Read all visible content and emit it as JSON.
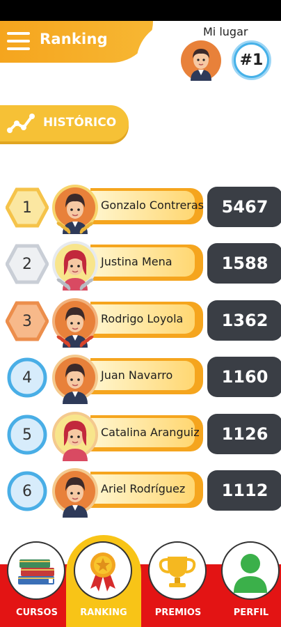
{
  "header": {
    "title": "Ranking",
    "my_place_label": "Mi lugar",
    "my_rank": "#1"
  },
  "historico": {
    "label": "HISTÓRICO"
  },
  "ranking": [
    {
      "pos": "1",
      "name": "Gonzalo Contreras",
      "score": "5467",
      "medal": "gold",
      "avatar": "boy"
    },
    {
      "pos": "2",
      "name": "Justina Mena",
      "score": "1588",
      "medal": "silver",
      "avatar": "girl"
    },
    {
      "pos": "3",
      "name": "Rodrigo Loyola",
      "score": "1362",
      "medal": "bronze",
      "avatar": "boy"
    },
    {
      "pos": "4",
      "name": "Juan Navarro",
      "score": "1160",
      "medal": "none",
      "avatar": "boy"
    },
    {
      "pos": "5",
      "name": "Catalina Aranguiz",
      "score": "1126",
      "medal": "none",
      "avatar": "girl"
    },
    {
      "pos": "6",
      "name": "Ariel Rodríguez",
      "score": "1112",
      "medal": "none",
      "avatar": "boy"
    }
  ],
  "nav": {
    "cursos": "CURSOS",
    "ranking": "RANKING",
    "premios": "PREMIOS",
    "perfil": "PERFIL"
  },
  "colors": {
    "orange": "#f5a51e",
    "yellow": "#f6c136",
    "dark_score": "#3a3e45",
    "red_nav": "#e31414",
    "blue_badge": "#46b1e8"
  }
}
